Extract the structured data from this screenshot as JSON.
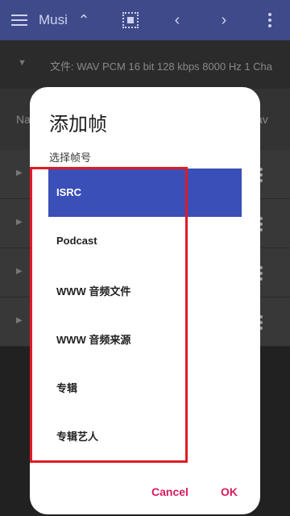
{
  "app_bar": {
    "title": "Musi",
    "icons": [
      "menu-icon",
      "chevron-up-icon",
      "select-all-icon",
      "chevron-left-icon",
      "chevron-right-icon",
      "more-vert-icon"
    ]
  },
  "background": {
    "file_info": "文件: WAV PCM 16 bit 128 kbps 8000 Hz 1 Cha",
    "field_label": "Na",
    "field_value": "av"
  },
  "dialog": {
    "title": "添加帧",
    "subtitle": "选择帧号",
    "options": [
      {
        "label": "ISRC",
        "selected": true
      },
      {
        "label": "Podcast",
        "selected": false
      },
      {
        "label": "WWW 音频文件",
        "selected": false
      },
      {
        "label": "WWW 音频来源",
        "selected": false
      },
      {
        "label": "专辑",
        "selected": false
      },
      {
        "label": "专辑艺人",
        "selected": false
      }
    ],
    "cancel_label": "Cancel",
    "ok_label": "OK"
  },
  "colors": {
    "app_bar": "#3f4a8a",
    "selected_option": "#3b4fb8",
    "button_text": "#d81b60",
    "highlight_box": "#e01b24"
  }
}
